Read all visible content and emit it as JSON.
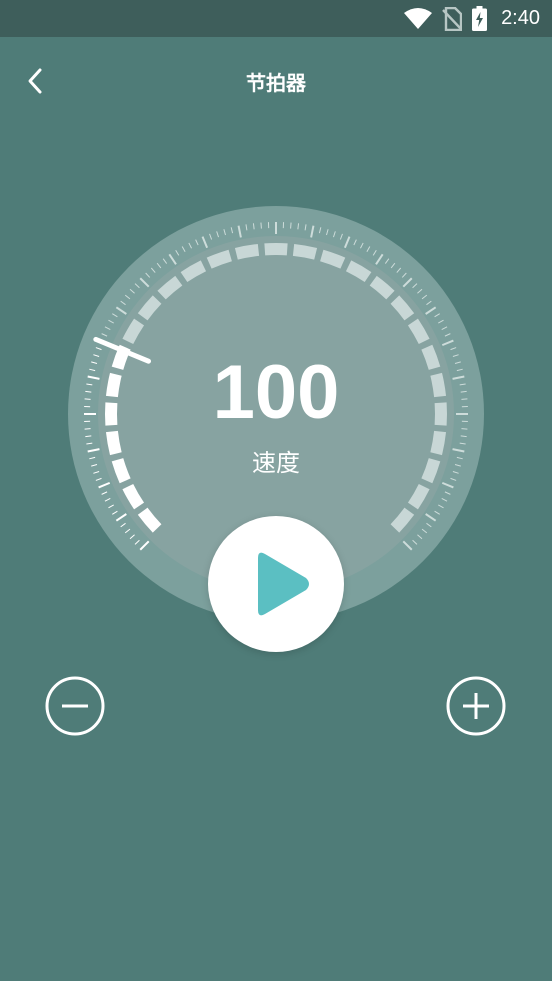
{
  "status_bar": {
    "time": "2:40",
    "icons": [
      "wifi-icon",
      "no-sim-icon",
      "battery-charging-icon"
    ]
  },
  "header": {
    "title": "节拍器",
    "back_icon": "chevron-left-icon"
  },
  "metronome": {
    "tempo": "100",
    "tempo_label": "速度",
    "level": 0.25,
    "play_icon": "play-icon",
    "decrease_icon": "minus-circle-icon",
    "increase_icon": "plus-circle-icon"
  },
  "colors": {
    "background": "#4f7c78",
    "status_bar": "#3e5e5b",
    "play_accent": "#5bbfc2"
  }
}
